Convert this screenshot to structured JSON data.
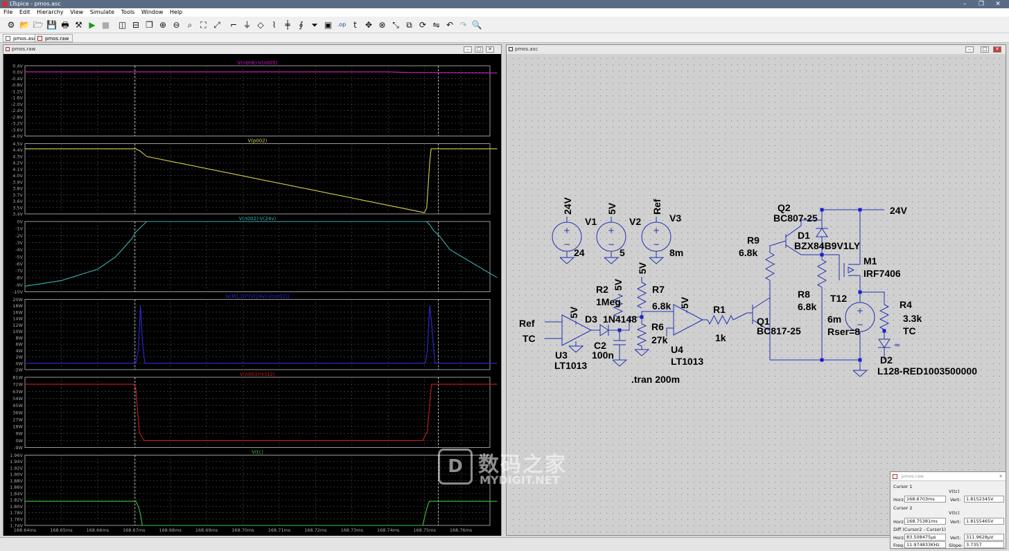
{
  "app": {
    "title": "LTspice - pmos.asc",
    "menu": [
      "File",
      "Edit",
      "Hierarchy",
      "View",
      "Simulate",
      "Tools",
      "Window",
      "Help"
    ],
    "toolbar_icons": [
      "gear-icon",
      "open-icon",
      "open-folder-icon",
      "save-icon",
      "print-icon",
      "control-panel-icon",
      "run-icon",
      "halt-icon",
      "tile-vertical-icon",
      "tile-horizontal-icon",
      "cascade-icon",
      "zoom-in-icon",
      "zoom-out-icon",
      "zoom-fit-icon",
      "zoom-full-icon",
      "autoscale-icon",
      "wire-icon",
      "ground-icon",
      "label-icon",
      "resistor-icon",
      "capacitor-icon",
      "inductor-icon",
      "diode-icon",
      "component-icon",
      "spice-directive-icon",
      "text-icon",
      "move-icon",
      "delete-icon",
      "drag-icon",
      "duplicate-icon",
      "rotate-icon",
      "mirror-icon",
      "undo-icon",
      "redo-icon",
      "find-icon"
    ],
    "tabs": [
      "pmos.asc",
      "pmos.raw"
    ]
  },
  "waveform_pane": {
    "title": "pmos.raw",
    "x_tick_labels": [
      "168.64ms",
      "168.65ms",
      "168.66ms",
      "168.67ms",
      "168.68ms",
      "168.69ms",
      "168.70ms",
      "168.71ms",
      "168.72ms",
      "168.73ms",
      "168.74ms",
      "168.75ms",
      "168.76ms"
    ],
    "colors": {
      "plot_bg": "#000000",
      "grid": "#404040",
      "cursor": "#e0e0e0"
    }
  },
  "chart_data": [
    {
      "type": "line",
      "title": "V(n006)-V(n005)",
      "color": "#d21ec8",
      "ylim": [
        -4.0,
        0.4
      ],
      "y_tick_labels": [
        "0.4V",
        "0.0V",
        "-0.4V",
        "-0.8V",
        "-1.2V",
        "-1.6V",
        "-2.0V",
        "-2.4V",
        "-2.8V",
        "-3.2V",
        "-3.6V",
        "-4.0V"
      ],
      "x": [
        168.64,
        168.74,
        168.745,
        168.77
      ],
      "values": [
        0.02,
        0.02,
        -0.02,
        -0.05
      ]
    },
    {
      "type": "line",
      "title": "V(p002)",
      "color": "#d4d44a",
      "ylim": [
        3.4,
        4.5
      ],
      "y_tick_labels": [
        "4.5V",
        "4.4V",
        "4.3V",
        "4.2V",
        "4.1V",
        "4.0V",
        "3.9V",
        "3.8V",
        "3.7V",
        "3.6V",
        "3.5V",
        "3.4V"
      ],
      "x": [
        168.64,
        168.6705,
        168.6718,
        168.6735,
        168.75,
        168.7506,
        168.7514,
        168.7518,
        168.77
      ],
      "values": [
        4.42,
        4.42,
        4.38,
        4.3,
        3.42,
        3.5,
        4.2,
        4.42,
        4.42
      ]
    },
    {
      "type": "line",
      "title": "V(n002)-V(24v)",
      "color": "#3ab0b0",
      "ylim": [
        -10,
        0
      ],
      "y_tick_labels": [
        "0V",
        "-1V",
        "-2V",
        "-3V",
        "-4V",
        "-5V",
        "-6V",
        "-7V",
        "-8V",
        "-9V",
        "-10V"
      ],
      "x": [
        168.64,
        168.65,
        168.66,
        168.665,
        168.6695,
        168.6705,
        168.6725,
        168.6735,
        168.6745,
        168.7505,
        168.7515,
        168.7525,
        168.754,
        168.757,
        168.77
      ],
      "values": [
        -9.2,
        -8.4,
        -6.8,
        -5.0,
        -2.4,
        -1.5,
        -0.5,
        0.0,
        0.0,
        0.0,
        -0.5,
        -1.3,
        -2.0,
        -4.0,
        -8.0
      ]
    },
    {
      "type": "line",
      "title": "Ix(M1:D)*(V(24v)-V(n002))",
      "color": "#2a2ae0",
      "ylim": [
        -2,
        20
      ],
      "y_tick_labels": [
        "20W",
        "18W",
        "16W",
        "14W",
        "12W",
        "10W",
        "8W",
        "6W",
        "4W",
        "2W",
        "0W",
        "-2W"
      ],
      "x": [
        168.64,
        168.6705,
        168.6712,
        168.6718,
        168.6724,
        168.673,
        168.7502,
        168.7508,
        168.7514,
        168.752,
        168.7528,
        168.77
      ],
      "values": [
        0,
        0,
        4,
        18,
        6,
        0,
        0,
        4,
        18,
        12,
        0,
        0
      ]
    },
    {
      "type": "line",
      "title": "V(n003)*I(t12)",
      "color": "#c81e1e",
      "ylim": [
        -9,
        81
      ],
      "y_tick_labels": [
        "81W",
        "72W",
        "63W",
        "54W",
        "45W",
        "36W",
        "27W",
        "18W",
        "9W",
        "0W",
        "-9W"
      ],
      "x": [
        168.64,
        168.67,
        168.6705,
        168.6715,
        168.6728,
        168.7495,
        168.7508,
        168.7518,
        168.752,
        168.77
      ],
      "values": [
        72,
        72,
        68,
        10,
        0,
        0,
        12,
        68,
        72,
        72
      ]
    },
    {
      "type": "line",
      "title": "V(tc)",
      "color": "#3ac83a",
      "ylim": [
        1.74,
        1.96
      ],
      "y_tick_labels": [
        "1.96V",
        "1.94V",
        "1.92V",
        "1.90V",
        "1.88V",
        "1.86V",
        "1.84V",
        "1.82V",
        "1.80V",
        "1.78V",
        "1.76V",
        "1.74V"
      ],
      "x": [
        168.64,
        168.6705,
        168.6712,
        168.6718,
        168.6723,
        168.7495,
        168.7502,
        168.7508,
        168.7513,
        168.77
      ],
      "values": [
        1.8155,
        1.8155,
        1.8,
        1.775,
        1.74,
        1.74,
        1.775,
        1.8,
        1.8155,
        1.8155
      ]
    }
  ],
  "schematic": {
    "title": "pmos.asc",
    "directive": ".tran 200m",
    "net_labels": [
      "24V",
      "24V",
      "5V",
      "5V",
      "5V",
      "5V",
      "5V",
      "Ref",
      "Ref",
      "TC",
      "TC",
      "TC"
    ],
    "components": [
      {
        "ref": "V1",
        "value": "24"
      },
      {
        "ref": "V2",
        "value": "5"
      },
      {
        "ref": "V3",
        "value": "8m"
      },
      {
        "ref": "Q2",
        "value": "BC807-25"
      },
      {
        "ref": "D1",
        "value": "BZX84B9V1LY"
      },
      {
        "ref": "R9",
        "value": "6.8k"
      },
      {
        "ref": "M1",
        "value": "IRF7406"
      },
      {
        "ref": "R8",
        "value": "6.8k"
      },
      {
        "ref": "R7",
        "value": "6.8k"
      },
      {
        "ref": "R2",
        "value": "1Meg"
      },
      {
        "ref": "T12",
        "value": "6m"
      },
      {
        "ref": "Rser",
        "value": "Rser=8"
      },
      {
        "ref": "R4",
        "value": "3.3k"
      },
      {
        "ref": "R1",
        "value": "1k"
      },
      {
        "ref": "Q1",
        "value": "BC817-25"
      },
      {
        "ref": "D3",
        "value": "1N4148"
      },
      {
        "ref": "R6",
        "value": "27k"
      },
      {
        "ref": "C2",
        "value": "100n"
      },
      {
        "ref": "U3",
        "value": "LT1013"
      },
      {
        "ref": "U4",
        "value": "LT1013"
      },
      {
        "ref": "D2",
        "value": "L128-RED1003500000"
      }
    ],
    "colors": {
      "bg": "#d0d0d0",
      "wire": "#2030b0",
      "junction": "#1a1ad0",
      "text": "#000000"
    }
  },
  "cursor_window": {
    "title": "pmos.raw",
    "cursor1_label": "Cursor 1",
    "cursor1_trace": "V(tc)",
    "cursor1_horz": "168.6703ms",
    "cursor1_vert": "1.8152345V",
    "cursor2_label": "Cursor 2",
    "cursor2_trace": "V(tc)",
    "cursor2_horz": "168.75381ms",
    "cursor2_vert": "1.8155465V",
    "diff_label": "Diff (Cursor2 - Cursor1)",
    "diff_horz": "83.508475µs",
    "diff_vert": "311.9628µV",
    "freq": "11.974833KHz",
    "slope": "3.7357",
    "labels": {
      "horz": "Horz:",
      "vert": "Vert:",
      "freq": "Freq:",
      "slope": "Slope:"
    }
  },
  "watermark": {
    "cn": "数码之家",
    "en": "MYDIGIT.NET",
    "logo": "D"
  }
}
